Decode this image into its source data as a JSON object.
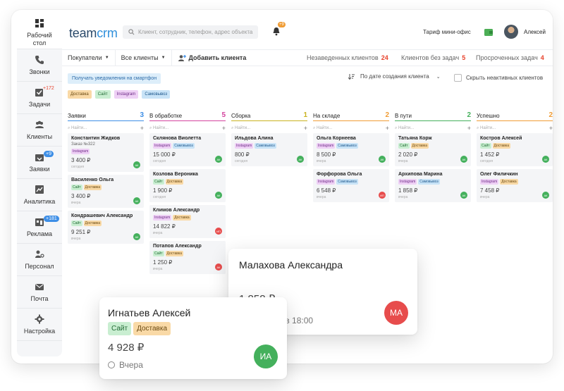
{
  "sidebar": {
    "items": [
      {
        "label": "Рабочий стол",
        "icon": "dashboard-icon",
        "badge": ""
      },
      {
        "label": "Звонки",
        "icon": "phone-icon",
        "badge": ""
      },
      {
        "label": "Задачи",
        "icon": "tasks-icon",
        "badge": "+172"
      },
      {
        "label": "Клиенты",
        "icon": "clients-icon",
        "badge": ""
      },
      {
        "label": "Заявки",
        "icon": "requests-icon",
        "badge": "+9"
      },
      {
        "label": "Аналитика",
        "icon": "analytics-icon",
        "badge": ""
      },
      {
        "label": "Реклама",
        "icon": "ads-icon",
        "badge": "+181"
      },
      {
        "label": "Персонал",
        "icon": "staff-icon",
        "badge": ""
      },
      {
        "label": "Почта",
        "icon": "mail-icon",
        "badge": ""
      },
      {
        "label": "Настройка",
        "icon": "gear-icon",
        "badge": ""
      }
    ]
  },
  "header": {
    "logo_team": "team",
    "logo_crm": "crm",
    "search_placeholder": "Клиент, сотрудник, телефон, адрес объекта",
    "bell_count": "+9",
    "tariff": "Тариф мини-офис",
    "user": "Алексей"
  },
  "filters": {
    "buyers": "Покупатели",
    "all_clients": "Все клиенты",
    "add_client": "Добавить клиента",
    "stats": [
      {
        "label": "Незаведенных клиентов",
        "count": "24",
        "color": "#e8432c"
      },
      {
        "label": "Клиентов без задач",
        "count": "5",
        "color": "#e8432c"
      },
      {
        "label": "Просроченных задач",
        "count": "4",
        "color": "#e8432c"
      }
    ]
  },
  "toolbar": {
    "notify": "Получать уведомления на смартфон",
    "sort": "По дате создания клиента",
    "hide_inactive": "Скрыть неактивных клиентов"
  },
  "tags": {
    "dost": "Доставка",
    "site": "Сайт",
    "inst": "Instagram",
    "samo": "Самовывоз"
  },
  "search_placeholder_small": "Найти...",
  "columns": [
    {
      "title": "Заявки",
      "count": "3",
      "color": "#3d8ee6",
      "cards": [
        {
          "name": "Константин Жидков",
          "sub": "Заказ №322",
          "tags": [
            "inst"
          ],
          "price": "3 400 ₽",
          "when": "сегодня",
          "av": "АК",
          "avc": "g"
        },
        {
          "name": "Василенко Ольга",
          "sub": "",
          "tags": [
            "site",
            "dost"
          ],
          "price": "3 400 ₽",
          "when": "вчера",
          "av": "АК",
          "avc": "g"
        },
        {
          "name": "Кондрашевич Александр",
          "sub": "",
          "tags": [
            "site",
            "dost"
          ],
          "price": "9 251 ₽",
          "when": "вчера",
          "av": "АК",
          "avc": "g"
        }
      ]
    },
    {
      "title": "В обработке",
      "count": "5",
      "color": "#d4439e",
      "cards": [
        {
          "name": "Склянова Виолетта",
          "sub": "",
          "tags": [
            "inst",
            "samo"
          ],
          "price": "15 000 ₽",
          "when": "сегодня",
          "av": "АК",
          "avc": "g"
        },
        {
          "name": "Козлова Вероника",
          "sub": "",
          "tags": [
            "site",
            "dost"
          ],
          "price": "1 900 ₽",
          "when": "сегодня",
          "av": "АК",
          "avc": "g"
        },
        {
          "name": "Климов Александр",
          "sub": "",
          "tags": [
            "inst",
            "dost"
          ],
          "price": "14 822 ₽",
          "when": "вчера",
          "av": "ИП",
          "avc": "r"
        },
        {
          "name": "Потапов Александр",
          "sub": "",
          "tags": [
            "site",
            "dost"
          ],
          "price": "1 250 ₽",
          "when": "вчера",
          "av": "АК",
          "avc": "r"
        }
      ]
    },
    {
      "title": "Сборка",
      "count": "1",
      "color": "#c9b21f",
      "cards": [
        {
          "name": "Ильдова Алина",
          "sub": "",
          "tags": [
            "inst",
            "samo"
          ],
          "price": "800 ₽",
          "when": "сегодня",
          "av": "АК",
          "avc": "g"
        }
      ]
    },
    {
      "title": "На складе",
      "count": "2",
      "color": "#f09c34",
      "cards": [
        {
          "name": "Ольга Корнеева",
          "sub": "",
          "tags": [
            "inst",
            "samo"
          ],
          "price": "8 500 ₽",
          "when": "вчера",
          "av": "АК",
          "avc": "g"
        },
        {
          "name": "Форфорова Ольга",
          "sub": "",
          "tags": [
            "inst",
            "samo"
          ],
          "price": "6 548 ₽",
          "when": "вчера",
          "av": "ИП",
          "avc": "r"
        }
      ]
    },
    {
      "title": "В пути",
      "count": "2",
      "color": "#44b05c",
      "cards": [
        {
          "name": "Татьяна Корж",
          "sub": "",
          "tags": [
            "site",
            "dost"
          ],
          "price": "2 020 ₽",
          "when": "вчера",
          "av": "АК",
          "avc": "g"
        },
        {
          "name": "Архипова Марина",
          "sub": "",
          "tags": [
            "inst",
            "samo"
          ],
          "price": "1 858 ₽",
          "when": "вчера",
          "av": "АК",
          "avc": "g"
        }
      ]
    },
    {
      "title": "Успешно",
      "count": "2",
      "color": "#f09c34",
      "cards": [
        {
          "name": "Кострoв Алексей",
          "sub": "",
          "tags": [
            "site",
            "dost"
          ],
          "price": "1 452 ₽",
          "when": "сегодня",
          "av": "АК",
          "avc": "g"
        },
        {
          "name": "Олег Филичкин",
          "sub": "",
          "tags": [
            "inst",
            "dost"
          ],
          "price": "7 458 ₽",
          "when": "вчера",
          "av": "АК",
          "avc": "g"
        }
      ]
    }
  ],
  "popup_malakhova": {
    "name": "Малахова Александра",
    "price": "1 858 ₽",
    "when": "Сегодня в 18:00",
    "av": "МА",
    "av_color": "#e74c4c"
  },
  "popup_ignatiev": {
    "name": "Игнатьев Алексей",
    "tags": [
      "Сайт",
      "Доставка"
    ],
    "price": "4 928 ₽",
    "when": "Вчера",
    "av": "ИА",
    "av_color": "#44b05c"
  }
}
